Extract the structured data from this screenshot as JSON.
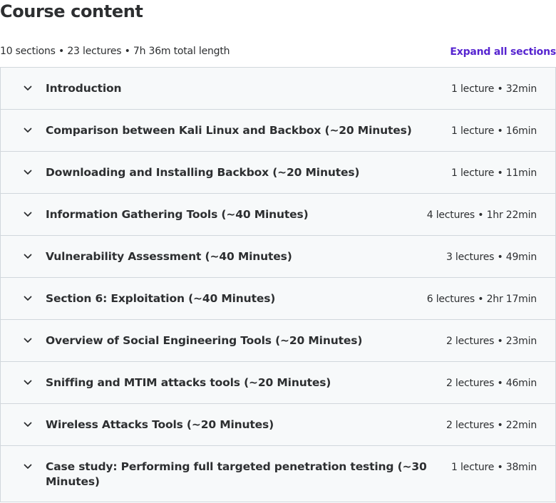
{
  "header": {
    "title": "Course content",
    "summary": "10 sections • 23 lectures • 7h 36m total length",
    "expand_all_label": "Expand all sections"
  },
  "colors": {
    "accent": "#5624d0",
    "section_bg": "#f7f9fa",
    "border": "#d1d7dc",
    "text": "#2d2f31"
  },
  "icons": {
    "section_toggle": "chevron-down-icon"
  },
  "sections": [
    {
      "title": "Introduction",
      "info": "1 lecture • 32min"
    },
    {
      "title": "Comparison between Kali Linux and Backbox (~20 Minutes)",
      "info": "1 lecture • 16min"
    },
    {
      "title": "Downloading and Installing Backbox (~20 Minutes)",
      "info": "1 lecture • 11min"
    },
    {
      "title": "Information Gathering Tools (~40 Minutes)",
      "info": "4 lectures • 1hr 22min"
    },
    {
      "title": "Vulnerability Assessment (~40 Minutes)",
      "info": "3 lectures • 49min"
    },
    {
      "title": "Section 6: Exploitation (~40 Minutes)",
      "info": "6 lectures • 2hr 17min"
    },
    {
      "title": "Overview of Social Engineering Tools (~20 Minutes)",
      "info": "2 lectures • 23min"
    },
    {
      "title": "Sniffing and MTIM attacks tools (~20 Minutes)",
      "info": "2 lectures • 46min"
    },
    {
      "title": "Wireless Attacks Tools (~20 Minutes)",
      "info": "2 lectures • 22min"
    },
    {
      "title": "Case study: Performing full targeted penetration testing (~30 Minutes)",
      "info": "1 lecture • 38min"
    }
  ]
}
